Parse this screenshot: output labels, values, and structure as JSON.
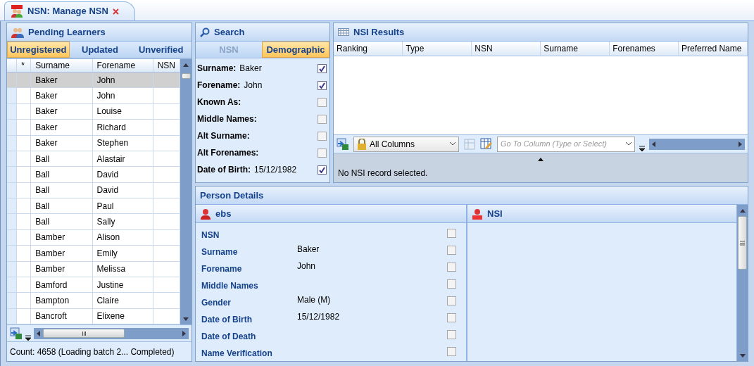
{
  "tab": {
    "title": "NSN: Manage NSN"
  },
  "pending": {
    "title": "Pending Learners",
    "tabs": [
      {
        "label": "Unregistered",
        "selected": true
      },
      {
        "label": "Updated",
        "selected": false
      },
      {
        "label": "Unverified",
        "selected": false
      }
    ],
    "columns": [
      "*",
      "Surname",
      "Forename",
      "NSN"
    ],
    "rows": [
      {
        "surname": "Baker",
        "forename": "John",
        "selected": true
      },
      {
        "surname": "Baker",
        "forename": "John",
        "selected": false
      },
      {
        "surname": "Baker",
        "forename": "Louise",
        "selected": false
      },
      {
        "surname": "Baker",
        "forename": "Richard",
        "selected": false
      },
      {
        "surname": "Baker",
        "forename": "Stephen",
        "selected": false
      },
      {
        "surname": "Ball",
        "forename": "Alastair",
        "selected": false
      },
      {
        "surname": "Ball",
        "forename": "David",
        "selected": false
      },
      {
        "surname": "Ball",
        "forename": "David",
        "selected": false
      },
      {
        "surname": "Ball",
        "forename": "Paul",
        "selected": false
      },
      {
        "surname": "Ball",
        "forename": "Sally",
        "selected": false
      },
      {
        "surname": "Bamber",
        "forename": "Alison",
        "selected": false
      },
      {
        "surname": "Bamber",
        "forename": "Emily",
        "selected": false
      },
      {
        "surname": "Bamber",
        "forename": "Melissa",
        "selected": false
      },
      {
        "surname": "Bamford",
        "forename": "Justine",
        "selected": false
      },
      {
        "surname": "Bampton",
        "forename": "Claire",
        "selected": false
      },
      {
        "surname": "Bancroft",
        "forename": "Elixene",
        "selected": false
      }
    ],
    "status": "Count: 4658 (Loading batch 2... Completed)"
  },
  "search": {
    "title": "Search",
    "tabs": [
      {
        "label": "NSN",
        "selected": false,
        "disabled": true
      },
      {
        "label": "Demographic",
        "selected": true,
        "disabled": false
      }
    ],
    "fields": [
      {
        "label": "Surname:",
        "value": "Baker",
        "checked": true
      },
      {
        "label": "Forename:",
        "value": "John",
        "checked": true
      },
      {
        "label": "Known As:",
        "checked": false
      },
      {
        "label": "Middle Names:",
        "checked": false
      },
      {
        "label": "Alt Surname:",
        "checked": false
      },
      {
        "label": "Alt Forenames:",
        "checked": false
      },
      {
        "label": "Date of Birth:",
        "value": "15/12/1982",
        "checked": true
      }
    ]
  },
  "results": {
    "title": "NSI Results",
    "columns": [
      "Ranking",
      "Type",
      "NSN",
      "Surname",
      "Forenames",
      "Preferred Name"
    ],
    "column_filter": "All Columns",
    "goto_placeholder": "Go To Column (Type or Select)",
    "message": "No NSI record selected."
  },
  "person": {
    "title": "Person Details",
    "ebs": {
      "title": "ebs",
      "fields": [
        {
          "label": "NSN",
          "checked": false
        },
        {
          "label": "Surname",
          "value": "Baker",
          "checked": false
        },
        {
          "label": "Forename",
          "value": "John",
          "checked": false
        },
        {
          "label": "Middle Names",
          "checked": false
        },
        {
          "label": "Gender",
          "value": "Male (M)",
          "checked": false
        },
        {
          "label": "Date of Birth",
          "value": "15/12/1982",
          "checked": false
        },
        {
          "label": "Date of Death",
          "checked": false
        },
        {
          "label": "Name Verification",
          "checked": false
        }
      ]
    },
    "nsi": {
      "title": "NSI"
    }
  }
}
